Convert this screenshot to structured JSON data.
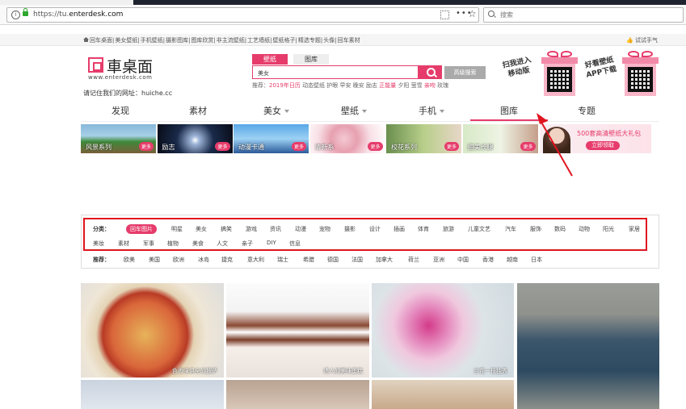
{
  "browser": {
    "url_prefix": "https://tu.",
    "url_domain": "enterdesk.com",
    "search_placeholder": "搜索"
  },
  "subnav": {
    "links": [
      "回车桌面",
      "美女壁纸",
      "手机壁纸",
      "摄影图库",
      "图库欣赏",
      "非主流壁纸",
      "工艺墙纸",
      "壁纸格子",
      "精选专题",
      "头像",
      "回车素材"
    ],
    "right_link": "试试手气"
  },
  "logo": {
    "name": "車桌面",
    "domain": "www.enterdesk.com"
  },
  "remember_text": "请记住我们的网址：huiche.cc",
  "search": {
    "tab_active": "壁纸",
    "tab_inactive": "图库",
    "value": "美女",
    "advanced": "高级搜索",
    "recommend_label": "推荐：",
    "recommend_hot": "2019年日历",
    "recommend_items": "动态壁纸 护眼 早安 晚安 励志",
    "recommend_hot2": "正能量",
    "recommend_items2": "夕阳 萤雪",
    "recommend_hot3": "亲吻",
    "recommend_items3": "玫瑰"
  },
  "promos": {
    "scan_line1": "扫我进入",
    "scan_line2": "移动版",
    "app_line1": "好看壁纸",
    "app_line2": "APP下载"
  },
  "main_nav": [
    {
      "label": "发现",
      "caret": false
    },
    {
      "label": "素材",
      "caret": false
    },
    {
      "label": "美女",
      "caret": true
    },
    {
      "label": "壁纸",
      "caret": true
    },
    {
      "label": "手机",
      "caret": true
    },
    {
      "label": "图库",
      "caret": false
    },
    {
      "label": "专题",
      "caret": false
    }
  ],
  "thumbs": [
    {
      "label": "风景系列",
      "more": "更多"
    },
    {
      "label": "励志",
      "more": "更多"
    },
    {
      "label": "动漫卡通",
      "more": "更多"
    },
    {
      "label": "清新系",
      "more": "更多"
    },
    {
      "label": "校花系列",
      "more": "更多"
    },
    {
      "label": "甜美长腿",
      "more": "更多"
    }
  ],
  "banner": {
    "title": "500套高清壁纸大礼包",
    "button": "立即领取"
  },
  "filters": {
    "category_label": "分类：",
    "categories_row1": [
      "回车图片",
      "明星",
      "美女",
      "搞笑",
      "游戏",
      "资讯",
      "动漫",
      "宠物",
      "摄影",
      "设计",
      "插画",
      "体育",
      "旅游",
      "儿童文艺",
      "汽车",
      "服饰",
      "数码",
      "动物",
      "阳光",
      "家居"
    ],
    "categories_row2": [
      "美妆",
      "素材",
      "军事",
      "植物",
      "美食",
      "人文",
      "亲子",
      "DIY",
      "信息"
    ],
    "recommend_label": "推荐：",
    "recommend": [
      "欧美",
      "美国",
      "欧洲",
      "冰岛",
      "捷克",
      "意大利",
      "瑞士",
      "希腊",
      "德国",
      "法国",
      "加拿大",
      "荷兰",
      "亚洲",
      "中国",
      "香港",
      "越南",
      "日本"
    ]
  },
  "photos": [
    {
      "caption": "色香味俱全的披萨"
    },
    {
      "caption": "诱人的美味蛋糕"
    },
    {
      "caption": "兰花一枝独秀"
    },
    {
      "caption": ""
    }
  ],
  "colors": {
    "accent": "#e63c6b",
    "highlight_box": "#e0151f"
  }
}
